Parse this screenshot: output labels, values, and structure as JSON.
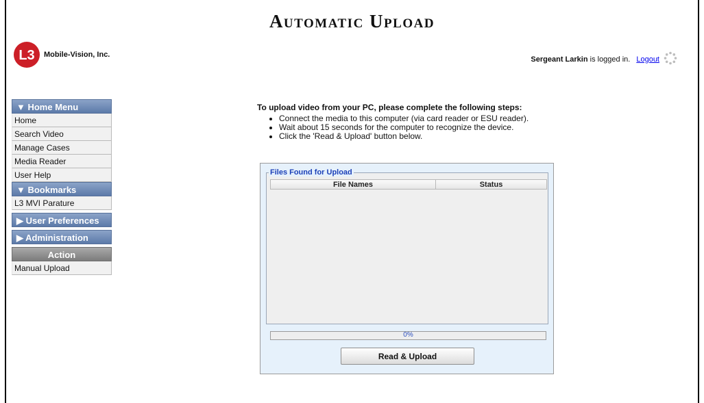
{
  "page": {
    "title": "Automatic Upload"
  },
  "brand": {
    "company": "Mobile-Vision, Inc.",
    "logo_text": "L3",
    "logo_color": "#cc1f27"
  },
  "user": {
    "name": "Sergeant Larkin",
    "status_text": "is logged in.",
    "logout_label": "Logout"
  },
  "sidebar": {
    "sections": [
      {
        "title": "▼  Home Menu",
        "items": [
          "Home",
          "Search Video",
          "Manage Cases",
          "Media Reader",
          "User Help"
        ]
      },
      {
        "title": "▼ Bookmarks",
        "items": [
          "L3 MVI Parature"
        ]
      },
      {
        "title": "▶  User Preferences",
        "items": []
      },
      {
        "title": "▶      Administration",
        "items": []
      },
      {
        "title": "Action",
        "items": [
          "Manual Upload"
        ]
      }
    ]
  },
  "instructions": {
    "heading": "To upload video from your PC, please complete the following steps:",
    "steps": [
      "Connect the media to this computer (via card reader or ESU reader).",
      "Wait about 15 seconds for the computer to recognize the device.",
      "Click the 'Read & Upload' button below."
    ]
  },
  "upload_panel": {
    "legend": "Files Found for Upload",
    "columns": [
      "File Names",
      "Status"
    ],
    "files": [],
    "progress_text": "0%",
    "progress_value": 0,
    "button_label": "Read & Upload"
  },
  "colors": {
    "menu_header": "#5c7aa9",
    "action_header": "#7c7c7c",
    "panel_bg": "#e6f1fb",
    "legend_text": "#1b3fb7",
    "link": "#0000ee"
  },
  "icons": {
    "loading": "loading-spinner-icon",
    "collapse": "triangle-down-icon",
    "expand": "triangle-right-icon"
  }
}
